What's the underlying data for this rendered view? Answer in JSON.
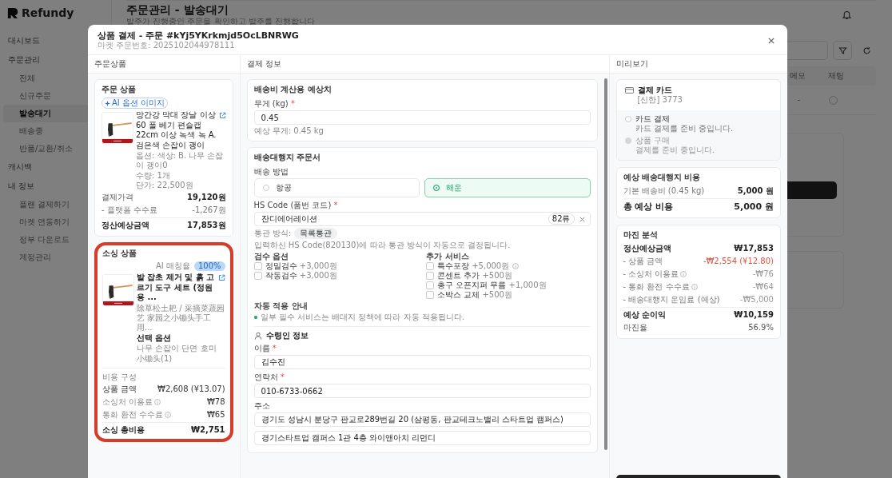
{
  "app": {
    "logo": "Refundy",
    "title": "주문관리 - 발송대기",
    "subtitle": "발주가 진행중인 주문을 확인하고 발주를 진행합니다",
    "sidebar": [
      {
        "label": "대시보드",
        "kind": "section",
        "selected": false
      },
      {
        "label": "주문관리",
        "kind": "section",
        "selected": false
      },
      {
        "label": "전체",
        "kind": "sub",
        "selected": false
      },
      {
        "label": "신규주문",
        "kind": "sub",
        "selected": false
      },
      {
        "label": "발송대기",
        "kind": "sub",
        "selected": true
      },
      {
        "label": "배송중",
        "kind": "sub",
        "selected": false
      },
      {
        "label": "반품/교환/취소",
        "kind": "sub",
        "selected": false
      },
      {
        "label": "캐시백",
        "kind": "section",
        "selected": false
      },
      {
        "label": "내 정보",
        "kind": "section",
        "selected": false
      },
      {
        "label": "플랜 결제하기",
        "kind": "sub",
        "selected": false
      },
      {
        "label": "마켓 연동하기",
        "kind": "sub",
        "selected": false
      },
      {
        "label": "정부 다운로드",
        "kind": "sub",
        "selected": false
      },
      {
        "label": "계정관리",
        "kind": "sub",
        "selected": false
      }
    ],
    "table_columns": [
      "메모",
      "재팅"
    ],
    "table_row": [
      "-"
    ]
  },
  "modal": {
    "title": "상품 결제 - 주문 #kYj5YKrkmjd5OcLBNRWG",
    "subtitle": "마켓 주문번호: 2025102044978111",
    "panels": [
      "주문상품",
      "결제 정보",
      "미리보기"
    ],
    "order_product": {
      "heading": "주문 상품",
      "badge": "AI 옵션 이미지",
      "name": "망간강 막대 장날 이상 60 풀 베기 편슬캡 22cm 이상 녹색 녹 A. 검은색 손잡이 괭이",
      "option": "옵션: 색상: B. 나무 손잡이 괭이0",
      "quantity": "수량: 1개",
      "unit_price": "단가: 22,500원",
      "rows": [
        {
          "label": "결제가격",
          "value": "19,120원",
          "kind": "normal"
        },
        {
          "label": "- 플랫폼 수수료",
          "value": "-1,267원",
          "kind": "minor"
        },
        {
          "label": "정산예상금액",
          "value": "17,853원",
          "kind": "total"
        }
      ]
    },
    "sourcing": {
      "highlighted": true,
      "heading": "소싱 상품",
      "match_label": "AI 매칭율",
      "match": "100%",
      "name": "발 잡초 제거 및 흙 고르기 도구 세트 (정원용 ...",
      "original_name": "除草松土耙 / 采摘菜蔬园艺 家园之小锄头手工用...",
      "option_label": "선택 옵션",
      "option_lines": [
        "나무 손잡이 단면 호미",
        "小锄头(1)"
      ],
      "cost_label": "비용 구성",
      "rows": [
        {
          "label": "상품 금액",
          "value": "₩2,608 (¥13.07)",
          "info": false
        },
        {
          "label": "소싱처 이용료",
          "value": "₩78",
          "info": true
        },
        {
          "label": "통화 환전 수수료",
          "value": "₩65",
          "info": true
        }
      ],
      "total_label": "소싱 총비용",
      "total": "₩2,751"
    },
    "shipping_estimate": {
      "heading": "배송비 계산용 예상치",
      "weight": {
        "label": "무게 (kg)",
        "required": "*",
        "value": "0.45"
      },
      "hint": "예상 무게: 0.45 kg"
    },
    "forwarder": {
      "heading": "배송대행지 주문서",
      "method_label": "배송 방법",
      "methods": [
        {
          "label": "항공",
          "selected": false
        },
        {
          "label": "해운",
          "selected": true
        }
      ],
      "hs": {
        "label": "HS Code (품번 코드)",
        "required": "*",
        "value": "잔디에어레이션",
        "badge": "82류"
      },
      "clearance_label": "통관 방식:",
      "clearance": "목록통관",
      "hs_note": "입력하신 HS Code(820130)에 따라 통관 방식이 자동으로 결정됩니다.",
      "inspection_label": "검수 옵션",
      "inspection": [
        {
          "label": "정밀검수",
          "price": "+3,000원",
          "checked": false,
          "info": false
        },
        {
          "label": "작동검수",
          "price": "+3,000원",
          "checked": false,
          "info": false
        }
      ],
      "services_label": "추가 서비스",
      "services": [
        {
          "label": "특수포장",
          "price": "+5,000원",
          "checked": false,
          "info": true
        },
        {
          "label": "콘센트 추가",
          "price": "+500원",
          "checked": false,
          "info": false
        },
        {
          "label": "총구 오픈지퍼 무름",
          "price": "+1,000원",
          "checked": false,
          "info": false
        },
        {
          "label": "소박스 교체",
          "price": "+500원",
          "checked": false,
          "info": false
        }
      ],
      "auto_label": "자동 적용 안내",
      "auto_note": "일부 필수 서비스는 배대지 정책에 따라 자동 적용됩니다."
    },
    "recipient": {
      "heading": "수령인 정보",
      "name": {
        "label": "이름",
        "required": "*",
        "value": "김수진"
      },
      "phone": {
        "label": "연락처",
        "required": "*",
        "value": "010-6733-0662"
      },
      "address_label": "주소",
      "address_lines": [
        "경기도 성남시 분당구 판교로289번길 20 (삼평동, 판교테크노밸리 스타트업 캠퍼스)",
        "경기스타트업 캠퍼스 1관 4층 와이앤아치 리먼디"
      ]
    },
    "preview": {
      "payment_card": {
        "title": "결제 카드",
        "detail": "[신한] 3773"
      },
      "payment_options": [
        {
          "title": "카드 결제",
          "desc": "카드 결제를 준비 중입니다.",
          "selected": false,
          "disabled": false
        },
        {
          "title": "상품 구매",
          "desc": "결제를 준비 중입니다.",
          "selected": false,
          "disabled": true
        }
      ],
      "shipping_cost": {
        "heading": "예상 배송대행지 비용",
        "rows": [
          {
            "label": "기본 배송비 (0.45 kg)",
            "value": "5,000 원"
          }
        ],
        "total_label": "총 예상 비용",
        "total": "5,000 원"
      },
      "margin": {
        "heading": "마진 분석",
        "rows": [
          {
            "label": "정산예상금액",
            "value": "₩17,853",
            "kind": "base",
            "info": false
          },
          {
            "label": "- 상품 금액",
            "value": "-₩2,554 (¥12.80)",
            "kind": "negative",
            "info": false
          },
          {
            "label": "- 소싱처 이용료",
            "value": "-₩76",
            "kind": "deduction",
            "info": true
          },
          {
            "label": "- 통화 환전 수수료",
            "value": "-₩64",
            "kind": "deduction",
            "info": true
          },
          {
            "label": "- 배송대행지 운임료 (예상)",
            "value": "-₩5,000",
            "kind": "deduction",
            "info": false
          },
          {
            "label": "예상 순이익",
            "value": "₩10,159",
            "kind": "total",
            "info": false
          },
          {
            "label": "마진율",
            "value": "56.9%",
            "kind": "rate",
            "info": false
          }
        ]
      }
    }
  }
}
